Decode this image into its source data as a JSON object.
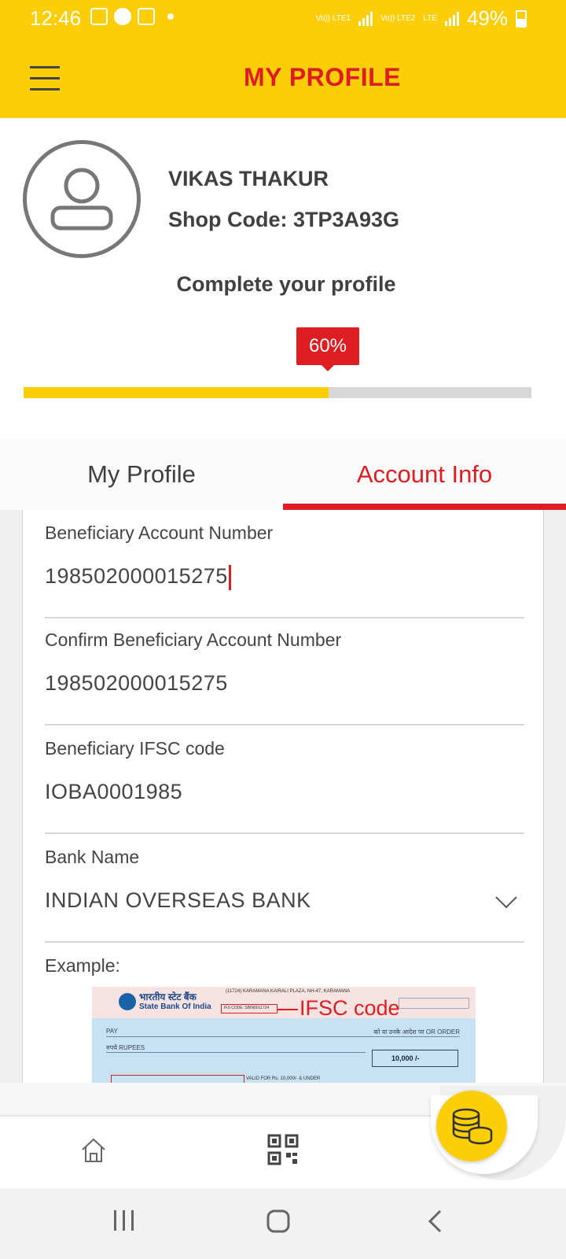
{
  "status_bar": {
    "time": "12:46",
    "sim1": "Vo)) LTE1",
    "sim2": "Vo)) LTE2",
    "lte": "LTE",
    "battery": "49%"
  },
  "app_bar": {
    "title": "MY PROFILE",
    "menu_icon": "hamburger-icon"
  },
  "profile": {
    "avatar_icon": "user-icon",
    "name": "VIKAS THAKUR",
    "shop_code": "Shop Code: 3TP3A93G",
    "complete_label": "Complete your profile",
    "progress_label": "60%",
    "progress_value": 0.6
  },
  "tabs": [
    {
      "label": "My Profile",
      "active": false
    },
    {
      "label": "Account Info",
      "active": true
    }
  ],
  "form": {
    "fields": [
      {
        "label": "Beneficiary Account Number",
        "value": "198502000015275"
      },
      {
        "label": "Confirm Beneficiary Account Number",
        "value": "198502000015275"
      },
      {
        "label": "Beneficiary IFSC code",
        "value": "IOBA0001985"
      },
      {
        "label": "Bank Name",
        "value": "INDIAN OVERSEAS BANK"
      }
    ],
    "example_label": "Example:"
  },
  "cheque": {
    "bank_hindi": "भारतीय स्टेट बैंक",
    "bank_name": "State Bank Of India",
    "address": "(11724) KARAMANA KAIRALI PLAZA, NH-47, KARAMANA",
    "ifsc_small": "IFS CODE: SBIN0011724",
    "ifsc_label": "IFSC code",
    "pay": "PAY",
    "pay_right": "को या उनके आदेश पर OR ORDER",
    "rupees": "रुपये RUPEES",
    "amount": "10,000 /-",
    "valid": "VALID FOR Rs. 10,000/- & UNDER"
  },
  "bottom_nav": {
    "home_icon": "home-icon",
    "qr_icon": "qr-code-icon",
    "coins_icon": "coins-icon"
  },
  "colors": {
    "brand_yellow": "#fbce07",
    "brand_red": "#dd1d21"
  }
}
